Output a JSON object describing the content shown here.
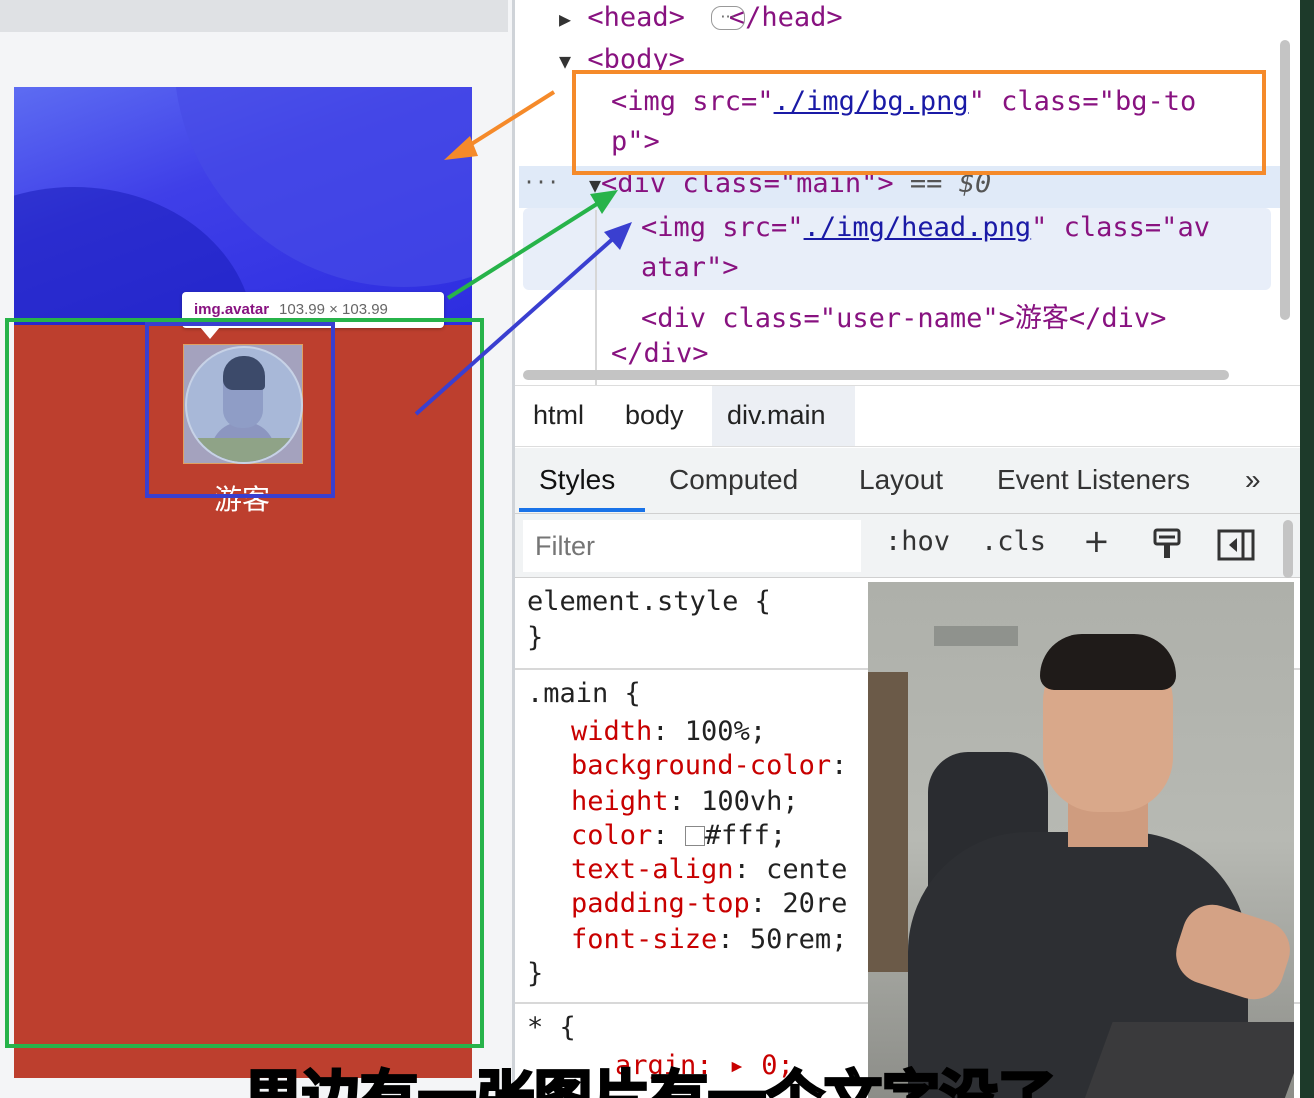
{
  "preview": {
    "user_name": "游客",
    "tooltip_selector": "img.avatar",
    "tooltip_size": "103.99 × 103.99"
  },
  "elements_panel": {
    "lines": {
      "head_open": "<head>",
      "head_close": "</head>",
      "head_ellipsis": "···",
      "body_open": "<body>",
      "img_bg_prefix": "<img src=\"",
      "img_bg_src": "./img/bg.png",
      "img_bg_suffix": "\" class=\"bg-to",
      "img_bg_wrap": "p\">",
      "dots": "···",
      "div_main": "<div class=\"main\">",
      "div_main_ref": "== $0",
      "img_head_prefix": "<img src=\"",
      "img_head_src": "./img/head.png",
      "img_head_suffix": "\" class=\"av",
      "img_head_wrap": "atar\">",
      "user_name_line": "<div class=\"user-name\">游客</div>",
      "div_close": "</div>"
    }
  },
  "breadcrumb": [
    "html",
    "body",
    "div.main"
  ],
  "tabs": [
    "Styles",
    "Computed",
    "Layout",
    "Event Listeners",
    "»"
  ],
  "filter": {
    "placeholder": "Filter",
    "hov": ":hov",
    "cls": ".cls",
    "plus": "+"
  },
  "styles": {
    "element_style": "element.style {",
    "close": "}",
    "main_selector": ".main {",
    "main_props": [
      {
        "name": "width",
        "value": "100%;"
      },
      {
        "name": "background-color",
        "value": ""
      },
      {
        "name": "height",
        "value": "100vh;"
      },
      {
        "name": "color",
        "value": "#fff;"
      },
      {
        "name": "text-align",
        "value": "cente"
      },
      {
        "name": "padding-top",
        "value": "20re"
      },
      {
        "name": "font-size",
        "value": "50rem;"
      }
    ],
    "universal_selector": "* {",
    "universal_partial": "argin: ▸ 0;"
  },
  "subtitle": "里边有一张图片有一个文字没了",
  "colors": {
    "orange_highlight": "#f58a2a",
    "green_highlight": "#27b34a",
    "blue_highlight": "#3a3fd0",
    "main_bg": "#bd3f2e"
  }
}
